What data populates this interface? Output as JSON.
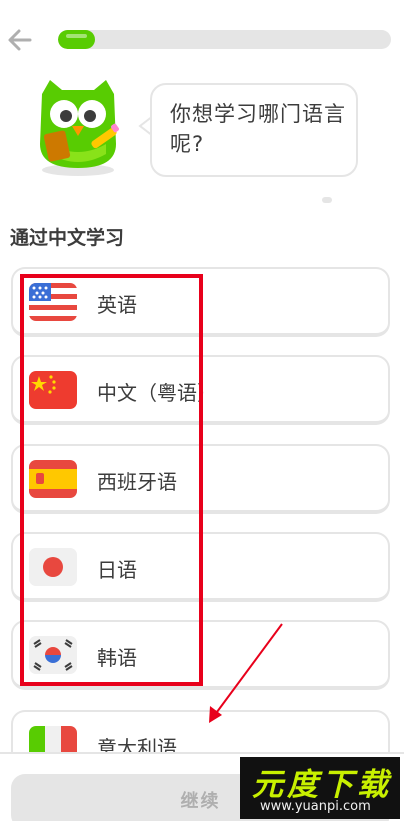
{
  "header": {
    "progress_fraction": 0.11
  },
  "prompt": {
    "question": "你想学习哪门语言呢?"
  },
  "section": {
    "title": "通过中文学习"
  },
  "languages": [
    {
      "label": "英语",
      "flag_icon": "us-flag-icon"
    },
    {
      "label": "中文（粤语）",
      "flag_icon": "china-flag-icon"
    },
    {
      "label": "西班牙语",
      "flag_icon": "spain-flag-icon"
    },
    {
      "label": "日语",
      "flag_icon": "japan-flag-icon"
    },
    {
      "label": "韩语",
      "flag_icon": "korea-flag-icon"
    },
    {
      "label": "意大利语",
      "flag_icon": "italy-flag-icon"
    }
  ],
  "footer": {
    "continue_label": "继续"
  },
  "watermark": {
    "title": "元度下载",
    "url": "www.yuanpi.com"
  },
  "colors": {
    "accent_green": "#58cc02",
    "annotation_red": "#e8001b",
    "border_gray": "#e5e5e5"
  }
}
